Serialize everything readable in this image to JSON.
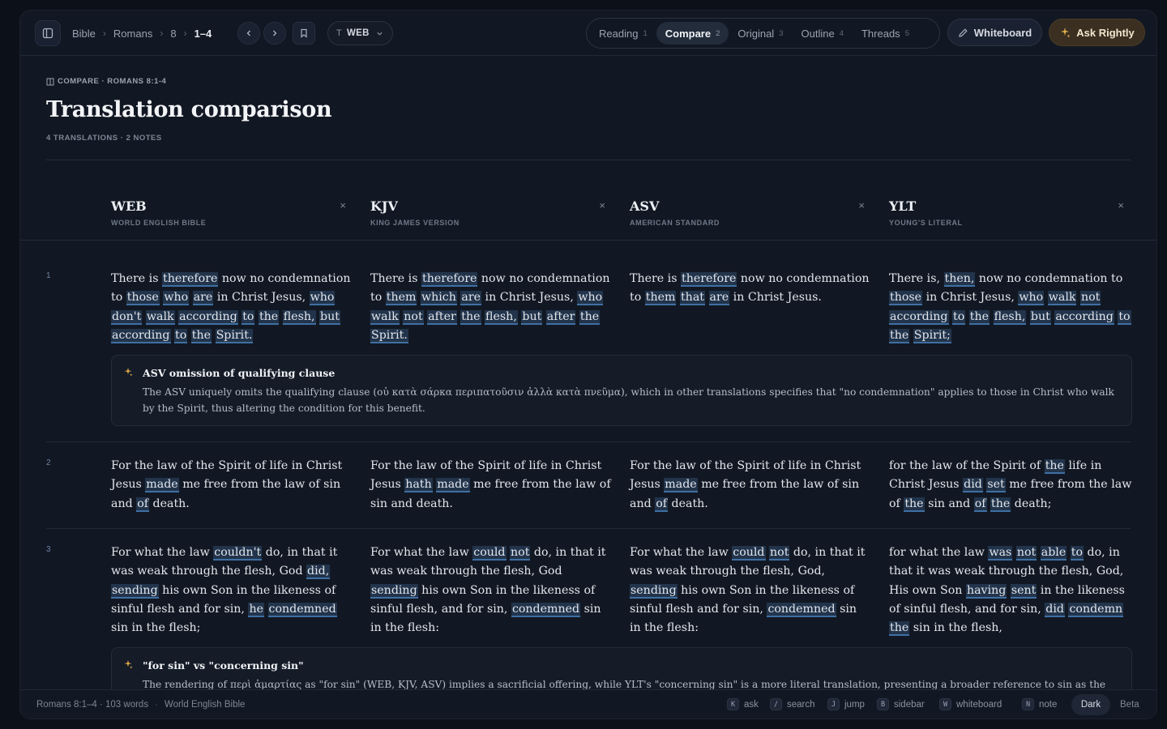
{
  "topbar": {
    "breadcrumb": [
      "Bible",
      "Romans",
      "8",
      "1–4"
    ],
    "translation_prefix": "T",
    "translation": "WEB",
    "tabs": [
      {
        "label": "Reading",
        "num": "1"
      },
      {
        "label": "Compare",
        "num": "2"
      },
      {
        "label": "Original",
        "num": "3"
      },
      {
        "label": "Outline",
        "num": "4"
      },
      {
        "label": "Threads",
        "num": "5"
      }
    ],
    "whiteboard_label": "Whiteboard",
    "ask_label": "Ask Rightly"
  },
  "header": {
    "eyebrow": "COMPARE · ROMANS 8:1-4",
    "title": "Translation comparison",
    "subline": "4 TRANSLATIONS · 2 NOTES"
  },
  "columns": [
    {
      "abbr": "WEB",
      "full": "WORLD ENGLISH BIBLE",
      "close": "×"
    },
    {
      "abbr": "KJV",
      "full": "KING JAMES VERSION",
      "close": "×"
    },
    {
      "abbr": "ASV",
      "full": "AMERICAN STANDARD",
      "close": "×"
    },
    {
      "abbr": "YLT",
      "full": "YOUNG'S LITERAL",
      "close": "×"
    }
  ],
  "verses": [
    {
      "num": "1",
      "texts": [
        "There is [therefore] now no condemnation to [those] [who] [are] in Christ Jesus, [who] [don't] [walk] [according] [to] [the] [flesh,] [but] [according] [to] [the] [Spirit.]",
        "There is [therefore] now no condemnation to [them] [which] [are] in Christ Jesus, [who] [walk] [not] [after] [the] [flesh,] [but] [after] [the] [Spirit.]",
        "There is [therefore] now no condemnation to [them] [that] [are] in Christ Jesus.",
        "There is, [then,] now no condemnation to [those] in Christ Jesus, [who] [walk] [not] [according] [to] [the] [flesh,] [but] [according] [to] [the] [Spirit;]"
      ],
      "note": {
        "title": "ASV omission of qualifying clause",
        "body": "The ASV uniquely omits the qualifying clause (οὐ κατὰ σάρκα περιπατοῦσιν ἀλλὰ κατὰ πνεῦμα), which in other translations specifies that \"no condemnation\" applies to those in Christ who walk by the Spirit, thus altering the condition for this benefit."
      }
    },
    {
      "num": "2",
      "texts": [
        "For the law of the Spirit of life in Christ Jesus [made] me free from the law of sin and [of] death.",
        "For the law of the Spirit of life in Christ Jesus [hath] [made] me free from the law of sin and death.",
        "For the law of the Spirit of life in Christ Jesus [made] me free from the law of sin and [of] death.",
        "for the law of the Spirit of [the] life in Christ Jesus [did] [set] me free from the law of [the] sin and [of] [the] death;"
      ]
    },
    {
      "num": "3",
      "texts": [
        "For what the law [couldn't] do, in that it was weak through the flesh, God [did,] [sending] his own Son in the likeness of sinful flesh and for sin, [he] [condemned] sin in the flesh;",
        "For what the law [could] [not] do, in that it was weak through the flesh, God [sending] his own Son in the likeness of sinful flesh, and for sin, [condemned] sin in the flesh:",
        "For what the law [could] [not] do, in that it was weak through the flesh, God, [sending] his own Son in the likeness of sinful flesh and for sin, [condemned] sin in the flesh:",
        "for what the law [was] [not] [able] [to] do, in that it was weak through the flesh, God, His own Son [having] [sent] in the likeness of sinful flesh, and for sin, [did] [condemn] [the] sin in the flesh,"
      ],
      "note": {
        "title": "\"for sin\" vs \"concerning sin\"",
        "body": "The rendering of περὶ ἁμαρτίας as \"for sin\" (WEB, KJV, ASV) implies a sacrificial offering, while YLT's \"concerning sin\" is a more literal translation, presenting a broader reference to sin as the"
      }
    }
  ],
  "footer": {
    "location": "Romans 8:1–4 · 103 words",
    "dot": "·",
    "translation": "World English Bible",
    "shortcuts": [
      {
        "key": "K",
        "label": "ask"
      },
      {
        "key": "/",
        "label": "search"
      },
      {
        "key": "J",
        "label": "jump"
      },
      {
        "key": "B",
        "label": "sidebar"
      },
      {
        "key": "W",
        "label": "whiteboard"
      },
      {
        "key": "N",
        "label": "note"
      }
    ],
    "theme": "Dark",
    "beta": "Beta"
  },
  "colors": {
    "accent_highlight": "#3f6fa3",
    "ask_accent": "#e6b04a",
    "background": "#121823"
  }
}
